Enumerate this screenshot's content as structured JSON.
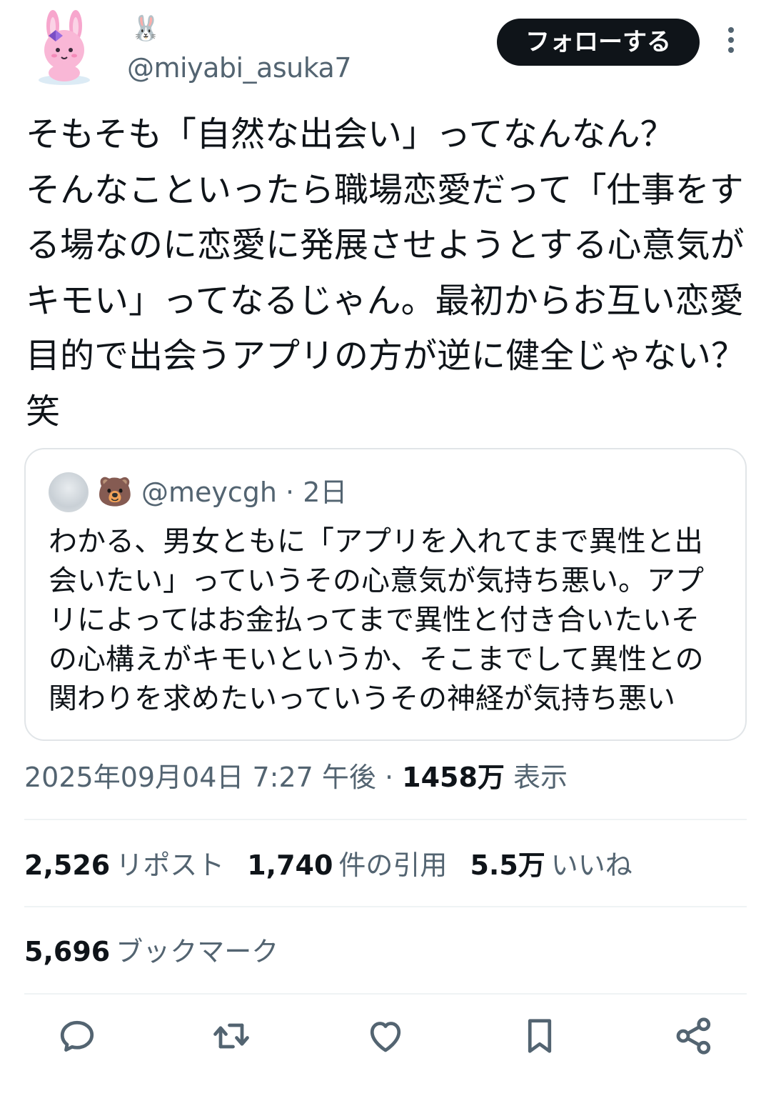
{
  "author": {
    "display_name": "🐰",
    "handle": "@miyabi_asuka7"
  },
  "follow_label": "フォローする",
  "tweet_text": "そもそも「自然な出会い」ってなんなん？\nそんなこといったら職場恋愛だって「仕事をする場なのに恋愛に発展させようとする心意気がキモい」ってなるじゃん。最初からお互い恋愛目的で出会うアプリの方が逆に健全じゃない？笑",
  "quote": {
    "display_name": "🐻",
    "handle_time": "@meycgh · 2日",
    "text": "わかる、男女ともに「アプリを入れてまで異性と出会いたい」っていうその心意気が気持ち悪い。アプリによってはお金払ってまで異性と付き合いたいその心構えがキモいというか、そこまでして異性との関わりを求めたいっていうその神経が気持ち悪い"
  },
  "meta": {
    "datetime": "2025年09月04日 7:27 午後 · ",
    "views": "1458万",
    "views_label": "表示"
  },
  "stats": {
    "reposts": {
      "num": "2,526",
      "label": "リポスト"
    },
    "quotes": {
      "num": "1,740",
      "label": "件の引用"
    },
    "likes": {
      "num": "5.5万",
      "label": "いいね"
    },
    "bookmarks": {
      "num": "5,696",
      "label": "ブックマーク"
    }
  },
  "icons": [
    "reply-icon",
    "repost-icon",
    "like-icon",
    "bookmark-icon",
    "share-icon",
    "more-icon"
  ],
  "colors": {
    "text": "#0f1419",
    "secondary": "#536471",
    "border": "#e1e5e8",
    "button": "#0f1419"
  }
}
